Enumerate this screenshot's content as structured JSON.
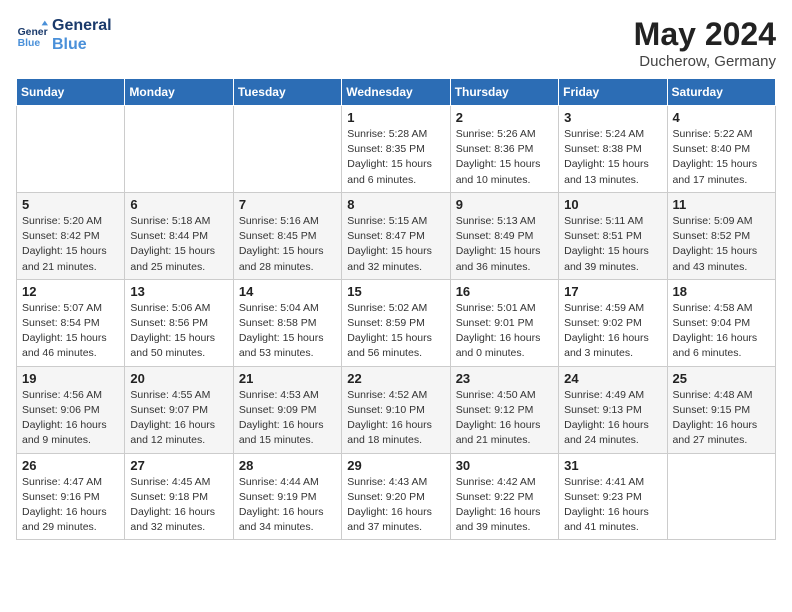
{
  "header": {
    "logo_line1": "General",
    "logo_line2": "Blue",
    "month_year": "May 2024",
    "location": "Ducherow, Germany"
  },
  "days_of_week": [
    "Sunday",
    "Monday",
    "Tuesday",
    "Wednesday",
    "Thursday",
    "Friday",
    "Saturday"
  ],
  "weeks": [
    [
      {
        "day": "",
        "info": ""
      },
      {
        "day": "",
        "info": ""
      },
      {
        "day": "",
        "info": ""
      },
      {
        "day": "1",
        "info": "Sunrise: 5:28 AM\nSunset: 8:35 PM\nDaylight: 15 hours\nand 6 minutes."
      },
      {
        "day": "2",
        "info": "Sunrise: 5:26 AM\nSunset: 8:36 PM\nDaylight: 15 hours\nand 10 minutes."
      },
      {
        "day": "3",
        "info": "Sunrise: 5:24 AM\nSunset: 8:38 PM\nDaylight: 15 hours\nand 13 minutes."
      },
      {
        "day": "4",
        "info": "Sunrise: 5:22 AM\nSunset: 8:40 PM\nDaylight: 15 hours\nand 17 minutes."
      }
    ],
    [
      {
        "day": "5",
        "info": "Sunrise: 5:20 AM\nSunset: 8:42 PM\nDaylight: 15 hours\nand 21 minutes."
      },
      {
        "day": "6",
        "info": "Sunrise: 5:18 AM\nSunset: 8:44 PM\nDaylight: 15 hours\nand 25 minutes."
      },
      {
        "day": "7",
        "info": "Sunrise: 5:16 AM\nSunset: 8:45 PM\nDaylight: 15 hours\nand 28 minutes."
      },
      {
        "day": "8",
        "info": "Sunrise: 5:15 AM\nSunset: 8:47 PM\nDaylight: 15 hours\nand 32 minutes."
      },
      {
        "day": "9",
        "info": "Sunrise: 5:13 AM\nSunset: 8:49 PM\nDaylight: 15 hours\nand 36 minutes."
      },
      {
        "day": "10",
        "info": "Sunrise: 5:11 AM\nSunset: 8:51 PM\nDaylight: 15 hours\nand 39 minutes."
      },
      {
        "day": "11",
        "info": "Sunrise: 5:09 AM\nSunset: 8:52 PM\nDaylight: 15 hours\nand 43 minutes."
      }
    ],
    [
      {
        "day": "12",
        "info": "Sunrise: 5:07 AM\nSunset: 8:54 PM\nDaylight: 15 hours\nand 46 minutes."
      },
      {
        "day": "13",
        "info": "Sunrise: 5:06 AM\nSunset: 8:56 PM\nDaylight: 15 hours\nand 50 minutes."
      },
      {
        "day": "14",
        "info": "Sunrise: 5:04 AM\nSunset: 8:58 PM\nDaylight: 15 hours\nand 53 minutes."
      },
      {
        "day": "15",
        "info": "Sunrise: 5:02 AM\nSunset: 8:59 PM\nDaylight: 15 hours\nand 56 minutes."
      },
      {
        "day": "16",
        "info": "Sunrise: 5:01 AM\nSunset: 9:01 PM\nDaylight: 16 hours\nand 0 minutes."
      },
      {
        "day": "17",
        "info": "Sunrise: 4:59 AM\nSunset: 9:02 PM\nDaylight: 16 hours\nand 3 minutes."
      },
      {
        "day": "18",
        "info": "Sunrise: 4:58 AM\nSunset: 9:04 PM\nDaylight: 16 hours\nand 6 minutes."
      }
    ],
    [
      {
        "day": "19",
        "info": "Sunrise: 4:56 AM\nSunset: 9:06 PM\nDaylight: 16 hours\nand 9 minutes."
      },
      {
        "day": "20",
        "info": "Sunrise: 4:55 AM\nSunset: 9:07 PM\nDaylight: 16 hours\nand 12 minutes."
      },
      {
        "day": "21",
        "info": "Sunrise: 4:53 AM\nSunset: 9:09 PM\nDaylight: 16 hours\nand 15 minutes."
      },
      {
        "day": "22",
        "info": "Sunrise: 4:52 AM\nSunset: 9:10 PM\nDaylight: 16 hours\nand 18 minutes."
      },
      {
        "day": "23",
        "info": "Sunrise: 4:50 AM\nSunset: 9:12 PM\nDaylight: 16 hours\nand 21 minutes."
      },
      {
        "day": "24",
        "info": "Sunrise: 4:49 AM\nSunset: 9:13 PM\nDaylight: 16 hours\nand 24 minutes."
      },
      {
        "day": "25",
        "info": "Sunrise: 4:48 AM\nSunset: 9:15 PM\nDaylight: 16 hours\nand 27 minutes."
      }
    ],
    [
      {
        "day": "26",
        "info": "Sunrise: 4:47 AM\nSunset: 9:16 PM\nDaylight: 16 hours\nand 29 minutes."
      },
      {
        "day": "27",
        "info": "Sunrise: 4:45 AM\nSunset: 9:18 PM\nDaylight: 16 hours\nand 32 minutes."
      },
      {
        "day": "28",
        "info": "Sunrise: 4:44 AM\nSunset: 9:19 PM\nDaylight: 16 hours\nand 34 minutes."
      },
      {
        "day": "29",
        "info": "Sunrise: 4:43 AM\nSunset: 9:20 PM\nDaylight: 16 hours\nand 37 minutes."
      },
      {
        "day": "30",
        "info": "Sunrise: 4:42 AM\nSunset: 9:22 PM\nDaylight: 16 hours\nand 39 minutes."
      },
      {
        "day": "31",
        "info": "Sunrise: 4:41 AM\nSunset: 9:23 PM\nDaylight: 16 hours\nand 41 minutes."
      },
      {
        "day": "",
        "info": ""
      }
    ]
  ]
}
